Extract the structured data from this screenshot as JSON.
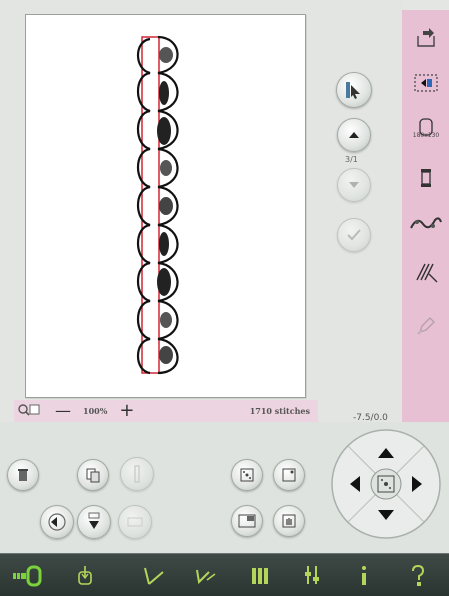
{
  "zoom": {
    "value_label": "100%",
    "minus_label": "—",
    "plus_label": "+",
    "stitch_count_label": "1710 stitches"
  },
  "navigation": {
    "page_label": "3/1",
    "coordinates_label": "-7.5/0.0"
  },
  "right_toolbar": {
    "hoop_size_label": "180x130"
  },
  "colors": {
    "accent_pink": "#e7c0d4",
    "design_outline": "#d01828",
    "taskbar_active": "#7bd23a",
    "taskbar_inactive": "#b3d65a"
  },
  "icons": {
    "taskbar": [
      "embroidery-edit-icon",
      "stitch-out-icon",
      "embroidery-stitch-icon",
      "sewing-stitch-icon",
      "menu-grid-icon",
      "settings-icon",
      "info-icon",
      "help-icon"
    ],
    "right_toolbar": [
      "load-icon",
      "hoop-select-icon",
      "hoop-size-icon",
      "thread-color-icon",
      "thread-cutting-icon",
      "stitch-density-icon",
      "disabled-pencil-icon"
    ]
  }
}
